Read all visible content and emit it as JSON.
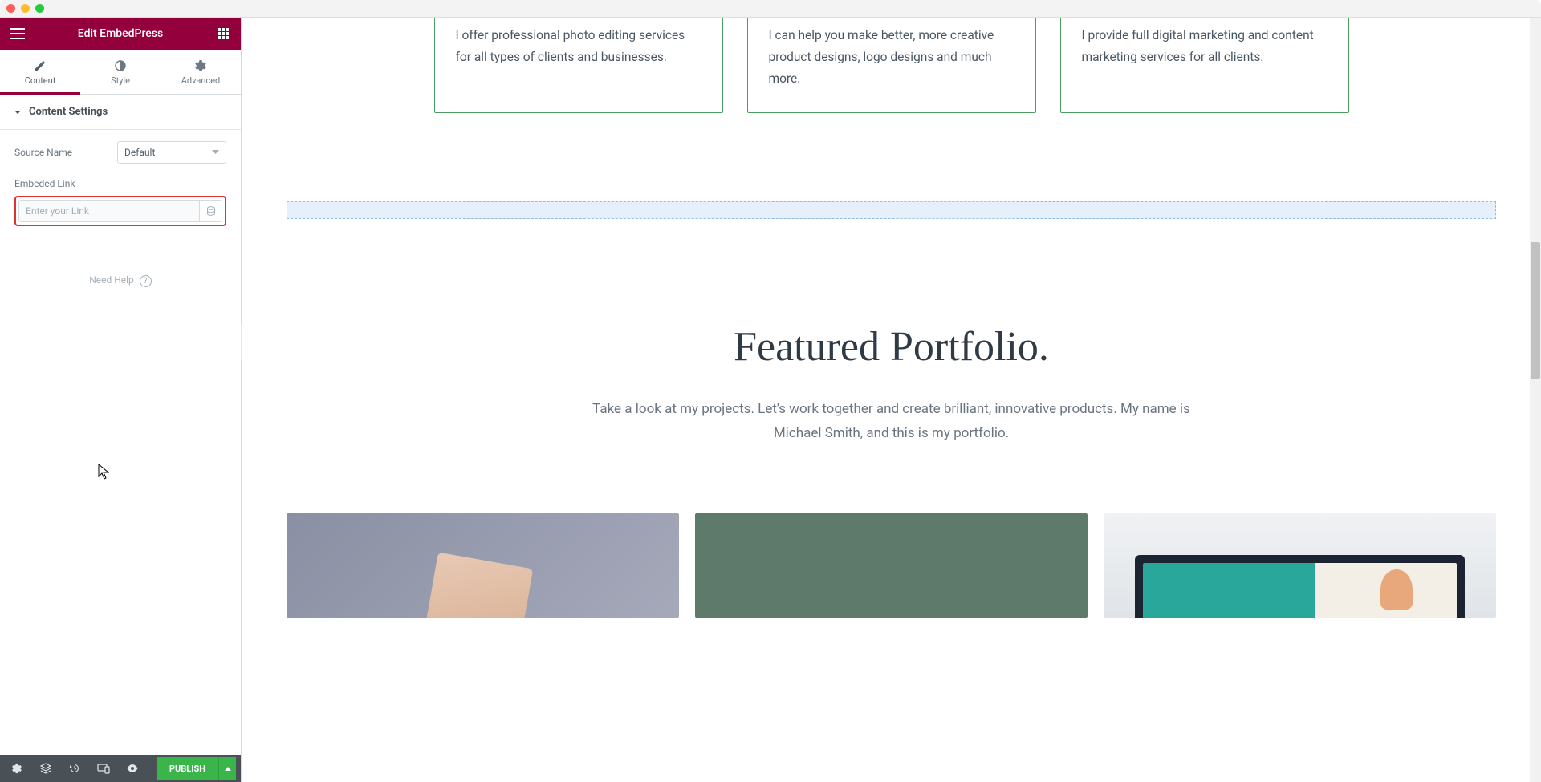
{
  "header": {
    "title": "Edit EmbedPress"
  },
  "tabs": {
    "content": "Content",
    "style": "Style",
    "advanced": "Advanced"
  },
  "section": {
    "title": "Content Settings"
  },
  "controls": {
    "source_label": "Source Name",
    "source_value": "Default",
    "embed_label": "Embeded Link",
    "embed_placeholder": "Enter your Link"
  },
  "help": {
    "text": "Need Help",
    "q": "?"
  },
  "bottombar": {
    "publish": "PUBLISH"
  },
  "canvas": {
    "cards": [
      "I offer professional photo editing services for all types of clients and businesses.",
      "I can help you make better, more creative product designs, logo designs and much more.",
      "I provide full digital marketing and content marketing services for all clients."
    ],
    "portfolio": {
      "title": "Featured Portfolio.",
      "subtitle": "Take a look at my projects. Let's work together and create brilliant, innovative products. My name is Michael Smith, and this is my portfolio."
    }
  }
}
